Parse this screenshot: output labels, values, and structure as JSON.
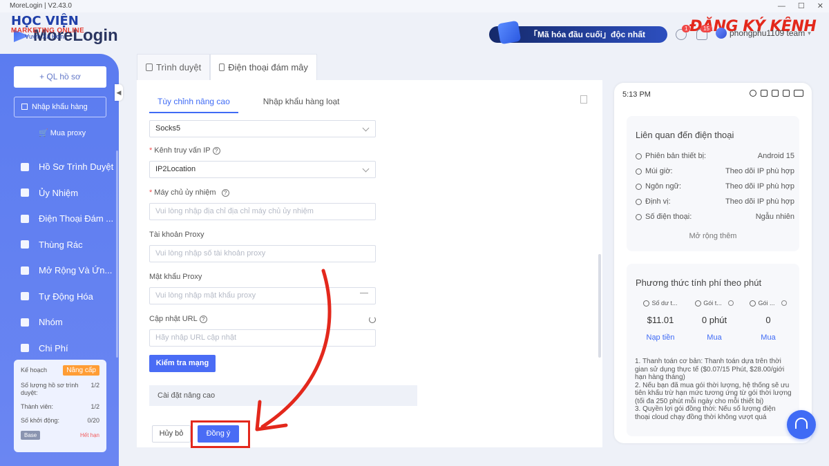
{
  "window": {
    "title": "MoreLogin | V2.43.0"
  },
  "watermark": {
    "brand_hv": "HỌC VIỆN",
    "brand_mo": "MARKETING ONLINE",
    "brand_sub": "Vươn Xa Hơn",
    "channel": "ĐĂNG KÝ KÊNH"
  },
  "header": {
    "logo": "MoreLogin",
    "promo": "「Mã hóa đầu cuối」độc nhất",
    "notif_badge_1": "1",
    "notif_badge_2": "15",
    "user": "phongphu1109 team"
  },
  "sidebar": {
    "new_profile": "+ QL hồ sơ",
    "import": "Nhập khẩu hàng",
    "buy_proxy": "Mua proxy",
    "items": [
      {
        "label": "Hồ Sơ Trình Duyệt",
        "icon": "browser-profile-icon"
      },
      {
        "label": "Ủy Nhiệm",
        "icon": "proxy-icon"
      },
      {
        "label": "Điện Thoại Đám ...",
        "icon": "cloud-phone-icon"
      },
      {
        "label": "Thùng Rác",
        "icon": "trash-icon"
      },
      {
        "label": "Mở Rộng Và Ứn...",
        "icon": "extension-icon"
      },
      {
        "label": "Tự Động Hóa",
        "icon": "automation-icon"
      },
      {
        "label": "Nhóm",
        "icon": "group-icon"
      },
      {
        "label": "Chi Phí",
        "icon": "billing-icon"
      }
    ],
    "plan": {
      "label": "Kế hoạch",
      "upgrade": "Nâng cấp",
      "profiles_label": "Số lượng hồ sơ trình duyệt:",
      "profiles_value": "1/2",
      "members_label": "Thành viên:",
      "members_value": "1/2",
      "launches_label": "Số khởi động:",
      "launches_value": "0/20",
      "tier": "Base",
      "expired": "Hết hạn"
    }
  },
  "tabs": [
    {
      "label": "Trình duyệt"
    },
    {
      "label": "Điện thoại đám mây"
    }
  ],
  "form": {
    "subtabs": [
      "Tùy chỉnh nâng cao",
      "Nhập khẩu hàng loạt"
    ],
    "proxy_type_value": "Socks5",
    "ip_channel_label": "Kênh truy vấn IP",
    "ip_channel_value": "IP2Location",
    "proxy_host_label": "Máy chủ ủy nhiệm",
    "proxy_host_placeholder": "Vui lòng nhập địa chỉ địa chỉ máy chủ ủy nhiệm",
    "proxy_account_label": "Tài khoản Proxy",
    "proxy_account_placeholder": "Vui lòng nhập số tài khoản proxy",
    "proxy_password_label": "Mật khẩu Proxy",
    "proxy_password_placeholder": "Vui lòng nhập mật khẩu proxy",
    "refresh_url_label": "Cập nhật URL",
    "refresh_url_placeholder": "Hãy nhập URL cập nhật",
    "check_button": "Kiểm tra mạng",
    "advanced": "Cài đặt nâng cao",
    "cancel": "Hủy bỏ",
    "ok": "Đồng ý"
  },
  "phone": {
    "time": "5:13 PM",
    "related_title": "Liên quan đến điện thoại",
    "rows": [
      {
        "k": "Phiên bản thiết bị:",
        "v": "Android 15"
      },
      {
        "k": "Múi giờ:",
        "v": "Theo dõi IP phù hợp"
      },
      {
        "k": "Ngôn ngữ:",
        "v": "Theo dõi IP phù hợp"
      },
      {
        "k": "Định vị:",
        "v": "Theo dõi IP phù hợp"
      },
      {
        "k": "Số điện thoại:",
        "v": "Ngẫu nhiên"
      }
    ],
    "expand": "Mở rộng thêm",
    "billing_title": "Phương thức tính phí theo phút",
    "cols": [
      {
        "h": "Số dư t...",
        "v": "$11.01",
        "a": "Nạp tiền"
      },
      {
        "h": "Gói t...",
        "v": "0 phút",
        "a": "Mua"
      },
      {
        "h": "Gói ...",
        "v": "0",
        "a": "Mua"
      }
    ],
    "notes": "1. Thanh toán cơ bản: Thanh toán dựa trên thời gian sử dụng thực tế ($0.07/15 Phút, $28.00/giới hạn hàng tháng)\n2. Nếu bạn đã mua gói thời lượng, hệ thống sẽ ưu tiên khấu trừ hạn mức tương ứng từ gói thời lượng (tối đa 250 phút mỗi ngày cho mỗi thiết bị)\n3. Quyền lợi gói đồng thời: Nếu số lượng điện thoại cloud chạy đồng thời không vượt quá"
  }
}
